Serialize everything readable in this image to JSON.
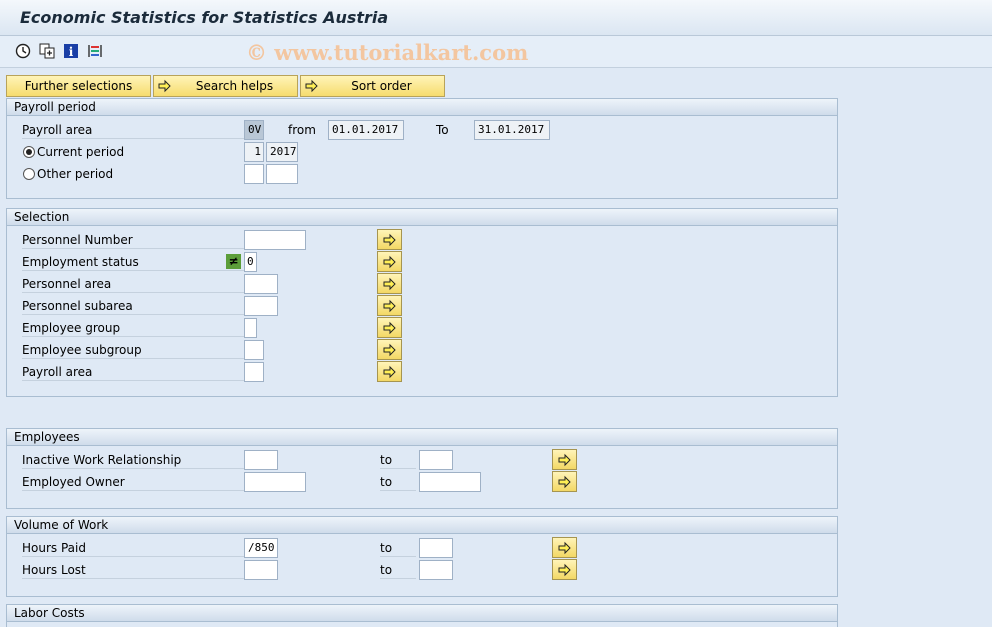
{
  "window": {
    "title": "Economic Statistics for Statistics Austria"
  },
  "toolbar": {
    "icons": [
      "execute-icon",
      "variant-icon",
      "info-icon",
      "layout-icon"
    ],
    "watermark": "© www.tutorialkart.com"
  },
  "buttons": {
    "further_selections": "Further selections",
    "search_helps": "Search helps",
    "sort_order": "Sort order"
  },
  "payroll_period": {
    "header": "Payroll period",
    "payroll_area_label": "Payroll area",
    "payroll_area_value": "0V",
    "from_label": "from",
    "from_value": "01.01.2017",
    "to_label": "To",
    "to_value": "31.01.2017",
    "current_period_label": "Current period",
    "current_period_num": "1",
    "current_period_year": "2017",
    "other_period_label": "Other period",
    "selected_radio": "current"
  },
  "selection": {
    "header": "Selection",
    "rows": [
      {
        "label": "Personnel Number",
        "value": ""
      },
      {
        "label": "Employment status",
        "value": "0"
      },
      {
        "label": "Personnel area",
        "value": ""
      },
      {
        "label": "Personnel subarea",
        "value": ""
      },
      {
        "label": "Employee group",
        "value": ""
      },
      {
        "label": "Employee subgroup",
        "value": ""
      },
      {
        "label": "Payroll area",
        "value": ""
      }
    ]
  },
  "employees": {
    "header": "Employees",
    "rows": [
      {
        "label": "Inactive Work Relationship",
        "value": "",
        "to_label": "to",
        "to_value": ""
      },
      {
        "label": "Employed Owner",
        "value": "",
        "to_label": "to",
        "to_value": ""
      }
    ]
  },
  "volume_of_work": {
    "header": "Volume of Work",
    "rows": [
      {
        "label": "Hours Paid",
        "value": "/850",
        "to_label": "to",
        "to_value": ""
      },
      {
        "label": "Hours Lost",
        "value": "",
        "to_label": "to",
        "to_value": ""
      }
    ]
  },
  "labor_costs": {
    "header": "Labor Costs"
  }
}
